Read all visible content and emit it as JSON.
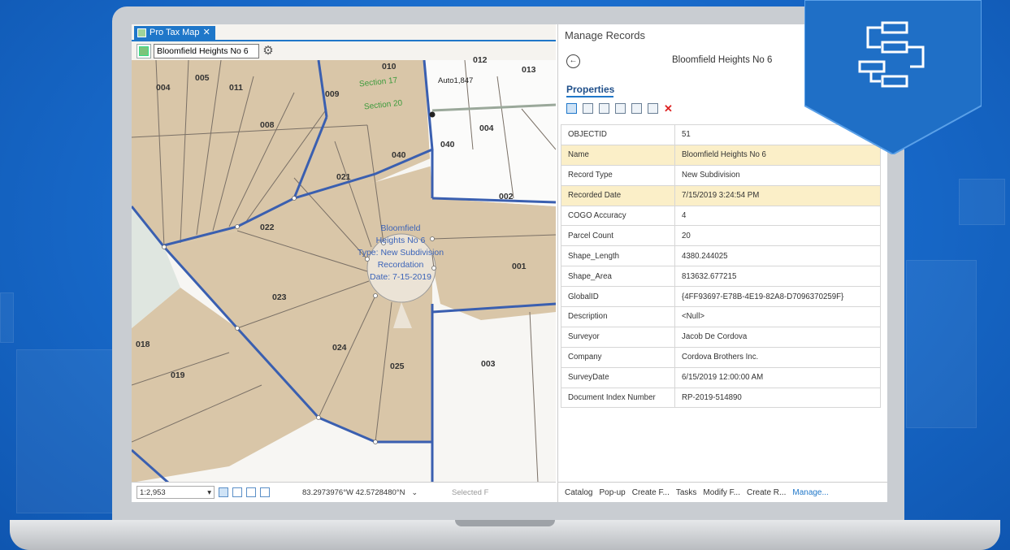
{
  "map": {
    "tab_label": "Pro Tax Map",
    "search_value": "Bloomfield Heights No 6",
    "labels": [
      "004",
      "005",
      "011",
      "009",
      "010",
      "012",
      "013",
      "008",
      "040",
      "040",
      "004",
      "021",
      "002",
      "022",
      "001",
      "023",
      "024",
      "025",
      "003",
      "018",
      "019"
    ],
    "section_labels": [
      "Section 17",
      "Section 20"
    ],
    "point_label": "Auto1,847",
    "parcel_annotation": [
      "Bloomfield",
      "Heights No 6",
      "Type: New Subdivision",
      "Recordation",
      "Date: 7-15-2019"
    ],
    "status": {
      "scale": "1:2,953",
      "coordinates": "83.2973976°W 42.5728480°N",
      "selected": "Selected F"
    }
  },
  "records": {
    "pane_title": "Manage Records",
    "record_name": "Bloomfield Heights No 6",
    "properties_tab": "Properties",
    "rows": [
      {
        "field": "OBJECTID",
        "value": "51"
      },
      {
        "field": "Name",
        "value": "Bloomfield Heights No 6"
      },
      {
        "field": "Record Type",
        "value": "New Subdivision"
      },
      {
        "field": "Recorded Date",
        "value": "7/15/2019 3:24:54 PM"
      },
      {
        "field": "COGO Accuracy",
        "value": "4"
      },
      {
        "field": "Parcel Count",
        "value": "20"
      },
      {
        "field": "Shape_Length",
        "value": "4380.244025"
      },
      {
        "field": "Shape_Area",
        "value": "813632.677215"
      },
      {
        "field": "GlobalID",
        "value": "{4FF93697-E78B-4E19-82A8-D7096370259F}"
      },
      {
        "field": "Description",
        "value": "<Null>"
      },
      {
        "field": "Surveyor",
        "value": "Jacob De Cordova"
      },
      {
        "field": "Company",
        "value": "Cordova Brothers Inc."
      },
      {
        "field": "SurveyDate",
        "value": "6/15/2019 12:00:00 AM"
      },
      {
        "field": "Document Index Number",
        "value": "RP-2019-514890"
      }
    ],
    "footer_tabs": [
      "Catalog",
      "Pop-up",
      "Create F...",
      "Tasks",
      "Modify F...",
      "Create R...",
      "Manage..."
    ]
  },
  "colors": {
    "accent": "#1f77c9",
    "parcel_fill": "#d9c6a8",
    "highlight_row": "#fbefc8",
    "boundary": "#3a5fb0"
  }
}
